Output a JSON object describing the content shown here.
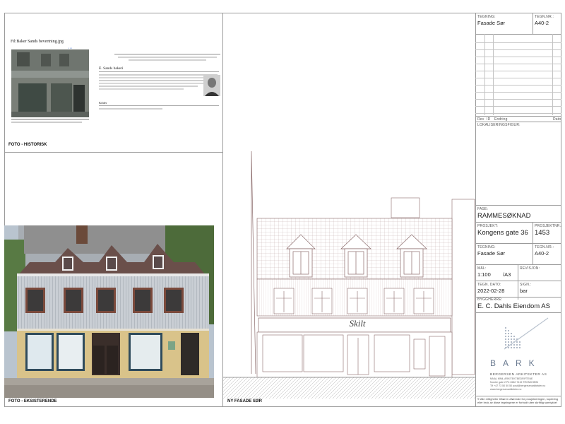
{
  "sheet": {
    "tegning_label": "TEGNING:",
    "tegning_value": "Fasade Sør",
    "tegnnr_label": "TEGN.NR.:",
    "tegnnr_value": "A40-2",
    "rev_headers": [
      "Rev",
      "ID",
      "Endring",
      "Dato"
    ],
    "lokalisering_label": "LOKALISERINGSFIGUR:",
    "fase_label": "FASE:",
    "fase_value": "RAMMESØKNAD",
    "prosjekt_label": "PROSJEKT:",
    "prosjekt_value": "Kongens gate 36",
    "prosjektnr_label": "PROSJEKTNR.:",
    "prosjektnr_value": "1453",
    "tegning2_label": "TEGNING:",
    "tegning2_value": "Fasade Sør",
    "tegnnr2_label": "TEGN.NR.:",
    "tegnnr2_value": "A40-2",
    "maal_label": "MÅL:",
    "maal_value": "1:100",
    "format_value": "/A3",
    "revisjon_label": "REVISJON:",
    "dato_label": "TEGN. DATO:",
    "dato_value": "2022-02-28",
    "sign_label": "SIGN.:",
    "sign_value": "bar",
    "byggherre_label": "BYGGHERRE:",
    "byggherre_value": "E. C. Dahls Eiendom AS",
    "firm_logo": "BARK",
    "firm_name": "BERGERSEN ARKITEKTER AS",
    "firm_tagline": "MNAL  MNIL  ARKITEKTBEDRIFTENE",
    "firm_address": "Nordre gate 2   Pb 2682   7415 TRONDHEIM",
    "firm_contact": "Tlf +47 73 50 50 50   post@bergersenarkitekter.no",
    "firm_web": "www.bergersenarkitekter.no",
    "copyright": "© Alle rettigheter tilhører utførende for prosjekteringen, kopiering eller bruk av disse tegningene er forbudt uten skriftlig samtykke!"
  },
  "captions": {
    "historic": "FOTO - HISTORISK",
    "existing": "FOTO - EKSISTERENDE",
    "new": "NY FASADE SØR"
  },
  "historic_page": {
    "filename": "Fil:Baker Sands bevertning.jpg",
    "article_title": "E. Sands bakeri",
    "toc_title": "Kilder"
  },
  "elevation": {
    "sign_text": "Skilt"
  },
  "colors": {
    "line": "#9a9a9a",
    "drawing": "#8a6a6a",
    "wall_existing": "#c8cdd3",
    "shop_existing": "#d9c38a"
  }
}
